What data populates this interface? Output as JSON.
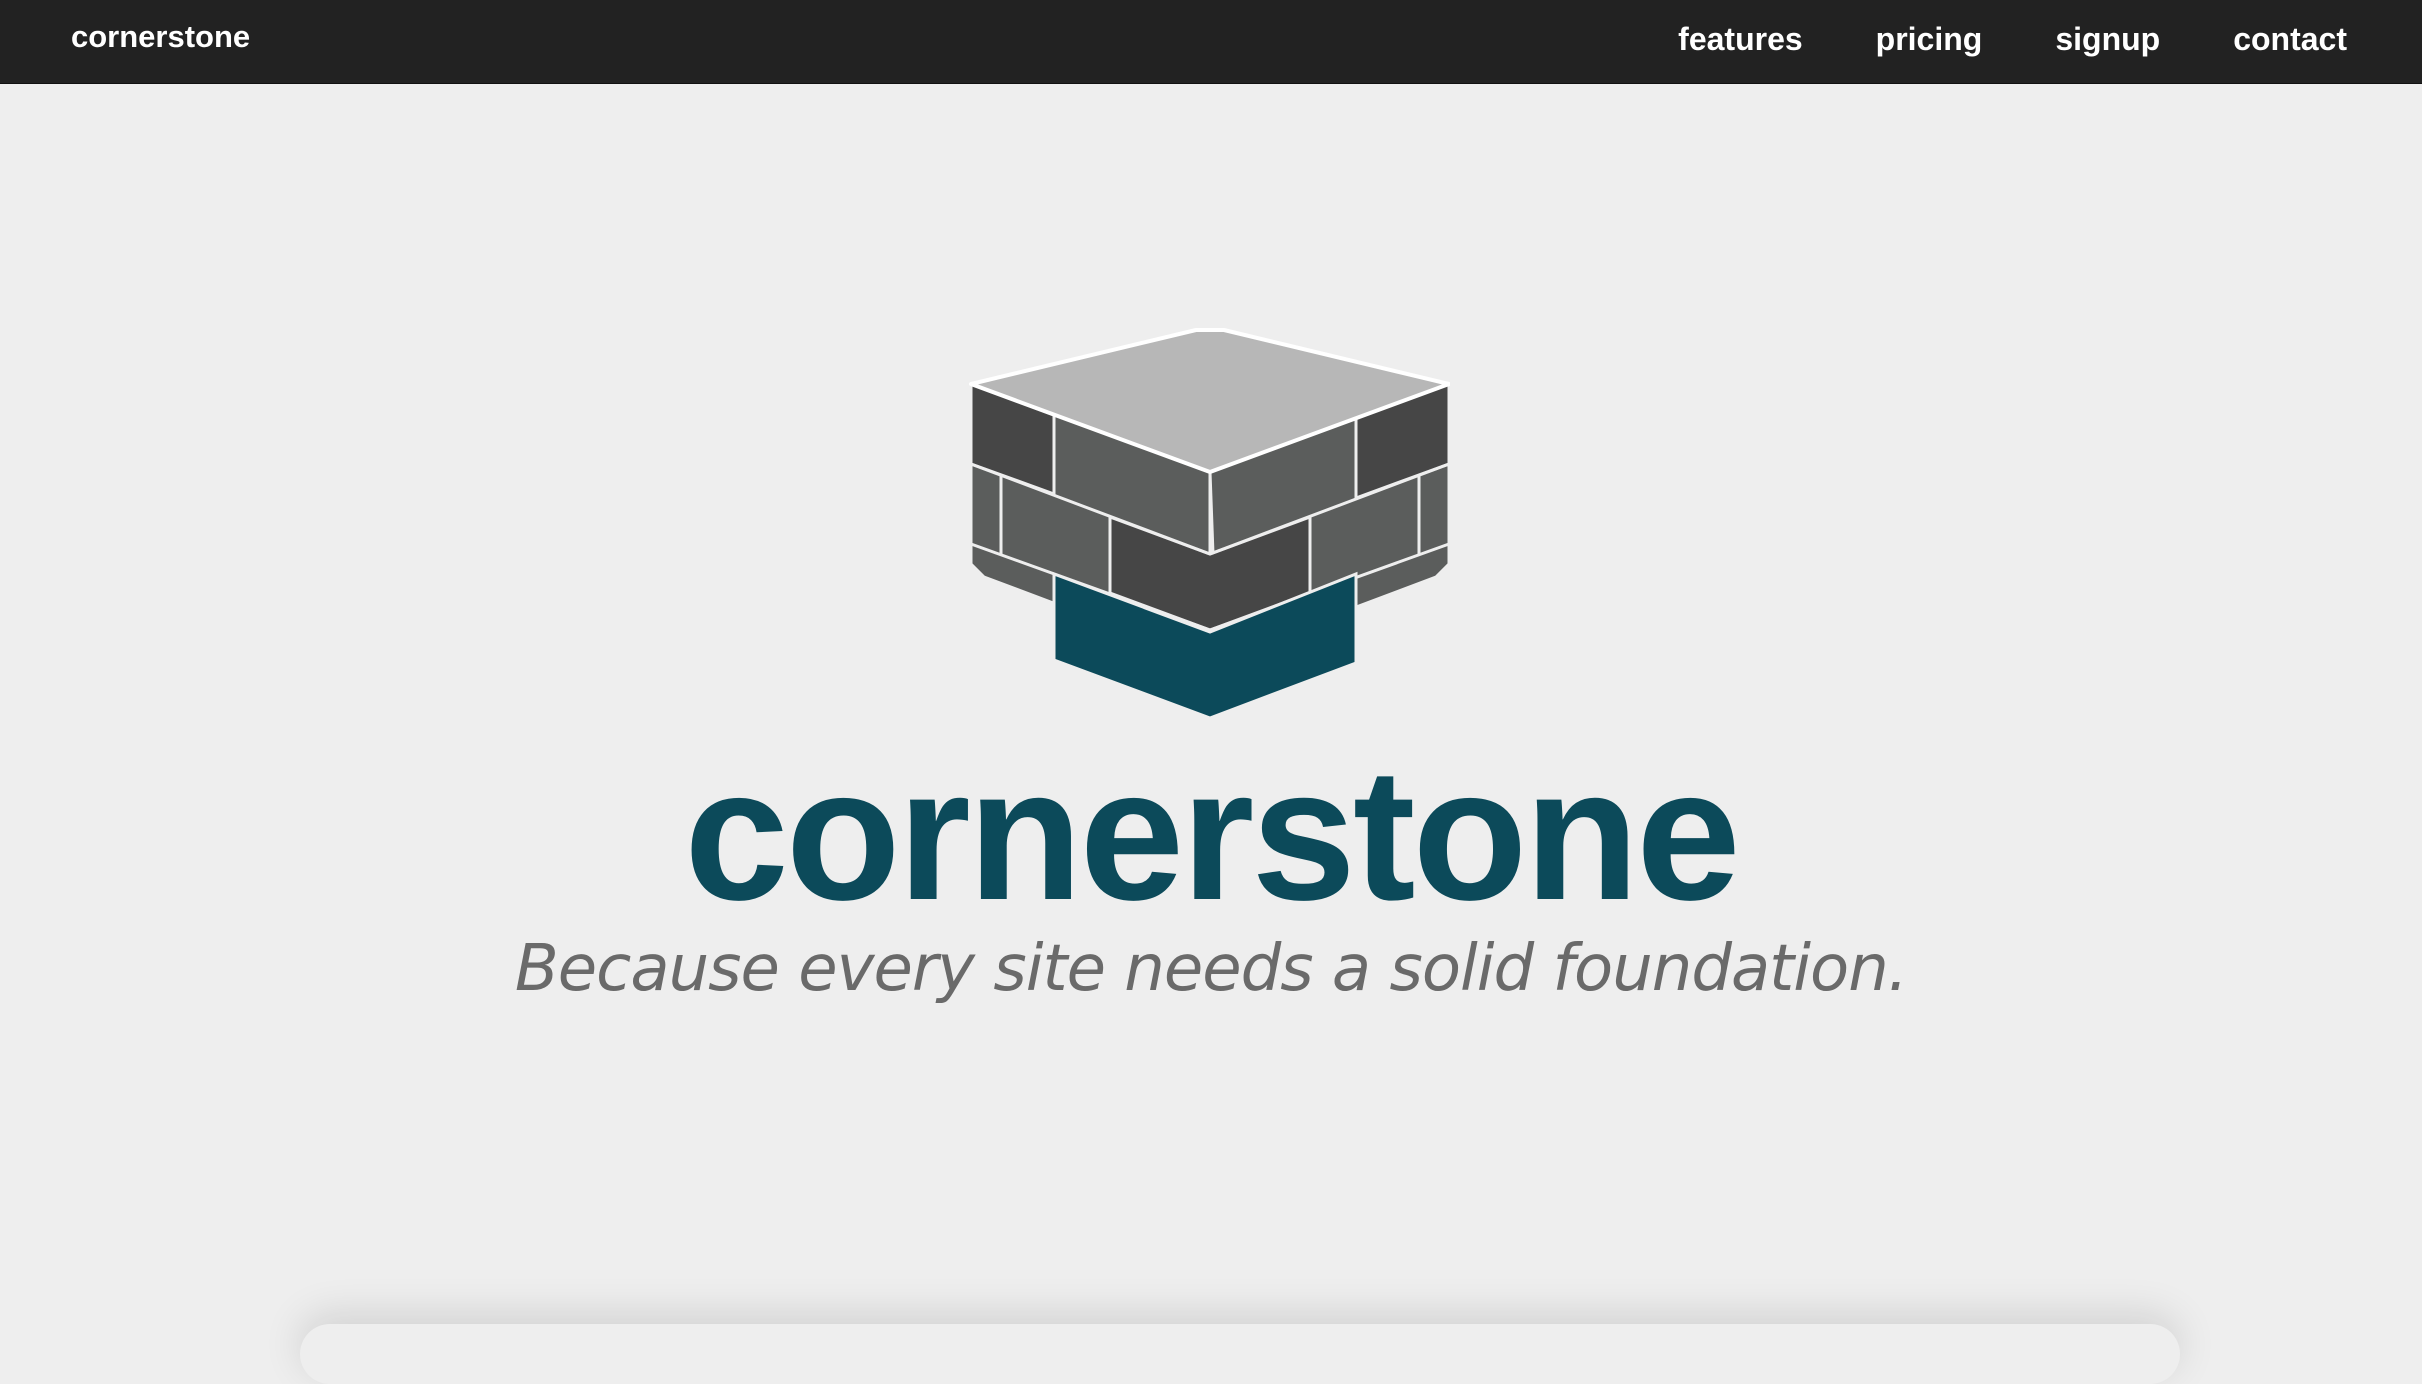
{
  "navbar": {
    "brand": "cornerstone",
    "links": [
      {
        "label": "features"
      },
      {
        "label": "pricing"
      },
      {
        "label": "signup"
      },
      {
        "label": "contact"
      }
    ]
  },
  "hero": {
    "title": "cornerstone",
    "tagline": "Because every site needs a solid foundation.",
    "logo_icon": "brick-cube-icon"
  },
  "colors": {
    "navbar_bg": "#222222",
    "page_bg": "#eeeeee",
    "brand_accent": "#0c4a5a",
    "tagline": "#6a6a6a"
  }
}
